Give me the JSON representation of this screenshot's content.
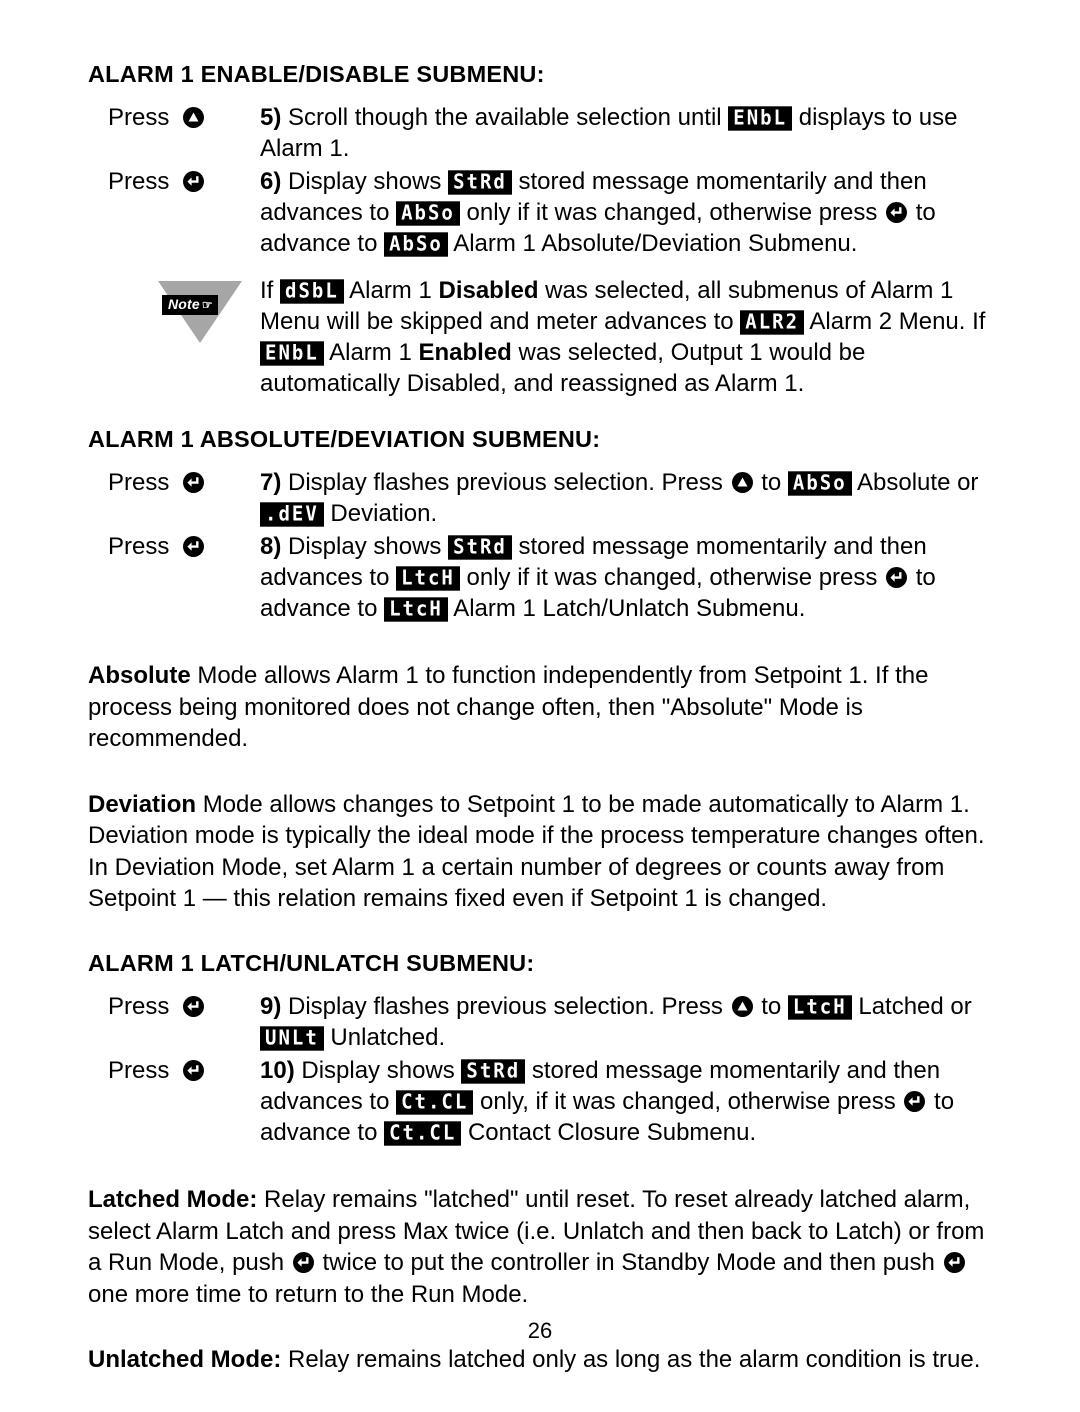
{
  "page": {
    "number": "26"
  },
  "icons": {
    "up_key": "up-arrow-key-icon",
    "enter_key": "enter-key-icon",
    "note": "note-triangle-icon",
    "note_label": "Note",
    "note_hand": "☞"
  },
  "sections": [
    {
      "id": "alarm1-enable-disable",
      "heading": "ALARM 1 ENABLE/DISABLE SUBMENU:",
      "steps": [
        {
          "press_label": "Press",
          "key": "up",
          "number": "5)",
          "parts": [
            {
              "t": "text",
              "v": " Scroll though the available selection until "
            },
            {
              "t": "lcd",
              "v": "ENbL"
            },
            {
              "t": "text",
              "v": " displays to use Alarm 1."
            }
          ]
        },
        {
          "press_label": "Press",
          "key": "enter",
          "number": "6)",
          "parts": [
            {
              "t": "text",
              "v": " Display shows "
            },
            {
              "t": "lcd",
              "v": "StRd"
            },
            {
              "t": "text",
              "v": " stored message momentarily and then advances to "
            },
            {
              "t": "lcd",
              "v": "AbSo"
            },
            {
              "t": "text",
              "v": " only if it was changed, otherwise press "
            },
            {
              "t": "key",
              "v": "enter"
            },
            {
              "t": "text",
              "v": " to advance to "
            },
            {
              "t": "lcd",
              "v": "AbSo"
            },
            {
              "t": "text",
              "v": " Alarm 1 Absolute/Deviation Submenu."
            }
          ]
        }
      ]
    },
    {
      "id": "alarm1-absolute-deviation",
      "heading": "ALARM 1 ABSOLUTE/DEVIATION SUBMENU:",
      "steps": [
        {
          "press_label": "Press",
          "key": "enter",
          "number": "7)",
          "parts": [
            {
              "t": "text",
              "v": " Display flashes previous selection. Press "
            },
            {
              "t": "key",
              "v": "up"
            },
            {
              "t": "text",
              "v": " to "
            },
            {
              "t": "lcd",
              "v": "AbSo"
            },
            {
              "t": "text",
              "v": " Absolute or "
            },
            {
              "t": "lcd",
              "v": ".dEV"
            },
            {
              "t": "text",
              "v": " Deviation."
            }
          ]
        },
        {
          "press_label": "Press",
          "key": "enter",
          "number": "8)",
          "parts": [
            {
              "t": "text",
              "v": " Display shows "
            },
            {
              "t": "lcd",
              "v": "StRd"
            },
            {
              "t": "text",
              "v": " stored message momentarily and then advances to "
            },
            {
              "t": "lcd",
              "v": "LtcH"
            },
            {
              "t": "text",
              "v": " only if it was changed, otherwise press "
            },
            {
              "t": "key",
              "v": "enter"
            },
            {
              "t": "text",
              "v": " to advance to "
            },
            {
              "t": "lcd",
              "v": "LtcH"
            },
            {
              "t": "text",
              "v": " Alarm 1 Latch/Unlatch Submenu."
            }
          ]
        }
      ]
    },
    {
      "id": "alarm1-latch-unlatch",
      "heading": "ALARM 1 LATCH/UNLATCH SUBMENU:",
      "steps": [
        {
          "press_label": "Press",
          "key": "enter",
          "number": "9)",
          "parts": [
            {
              "t": "text",
              "v": " Display flashes previous selection. Press "
            },
            {
              "t": "key",
              "v": "up"
            },
            {
              "t": "text",
              "v": " to "
            },
            {
              "t": "lcd",
              "v": "LtcH"
            },
            {
              "t": "text",
              "v": " Latched or "
            },
            {
              "t": "lcd",
              "v": "UNLt"
            },
            {
              "t": "text",
              "v": " Unlatched."
            }
          ]
        },
        {
          "press_label": "Press",
          "key": "enter",
          "number": "10)",
          "parts": [
            {
              "t": "text",
              "v": " Display shows "
            },
            {
              "t": "lcd",
              "v": "StRd"
            },
            {
              "t": "text",
              "v": " stored message momentarily and then advances to "
            },
            {
              "t": "lcd",
              "v": "Ct.CL"
            },
            {
              "t": "text",
              "v": " only, if it was changed, otherwise press "
            },
            {
              "t": "key",
              "v": "enter"
            },
            {
              "t": "text",
              "v": " to advance to "
            },
            {
              "t": "lcd",
              "v": "Ct.CL"
            },
            {
              "t": "text",
              "v": " Contact Closure Submenu."
            }
          ]
        }
      ]
    }
  ],
  "note": {
    "parts": [
      {
        "t": "text",
        "v": "If "
      },
      {
        "t": "lcd",
        "v": "dSbL"
      },
      {
        "t": "text",
        "v": " Alarm 1 "
      },
      {
        "t": "bold",
        "v": "Disabled"
      },
      {
        "t": "text",
        "v": " was selected, all submenus of Alarm 1 Menu will be skipped and meter advances to "
      },
      {
        "t": "lcd",
        "v": "ALR2"
      },
      {
        "t": "text",
        "v": " Alarm 2 Menu. If "
      },
      {
        "t": "lcd",
        "v": "ENbL"
      },
      {
        "t": "text",
        "v": " Alarm 1 "
      },
      {
        "t": "bold",
        "v": "Enabled"
      },
      {
        "t": "text",
        "v": " was selected, Output 1 would be automatically Disabled, and reassigned as Alarm 1."
      }
    ]
  },
  "paragraphs": {
    "absolute_mode": [
      {
        "t": "bold",
        "v": "Absolute"
      },
      {
        "t": "text",
        "v": " Mode allows Alarm 1 to function independently from Setpoint 1. If the process being monitored does not change often, then \"Absolute\" Mode is recommended."
      }
    ],
    "deviation_mode": [
      {
        "t": "bold",
        "v": "Deviation"
      },
      {
        "t": "text",
        "v": " Mode allows changes to Setpoint 1 to be made automatically to Alarm 1. Deviation mode is typically the ideal mode if the process temperature changes often. In Deviation Mode, set Alarm 1 a certain number of degrees or counts away from Setpoint 1 — this relation remains fixed even if Setpoint 1 is changed."
      }
    ],
    "latched_mode": [
      {
        "t": "bold",
        "v": "Latched Mode:"
      },
      {
        "t": "text",
        "v": " Relay remains \"latched\" until reset. To reset already latched alarm, select Alarm Latch and press Max twice (i.e. Unlatch and then back to Latch) or from a Run Mode, push "
      },
      {
        "t": "key",
        "v": "enter"
      },
      {
        "t": "text",
        "v": " twice to put the controller in Standby Mode and then push "
      },
      {
        "t": "key",
        "v": "enter"
      },
      {
        "t": "text",
        "v": " one more time to return to the Run Mode."
      }
    ],
    "unlatched_mode": [
      {
        "t": "bold",
        "v": "Unlatched Mode:"
      },
      {
        "t": "text",
        "v": " Relay remains latched only as long as the alarm condition is true."
      }
    ]
  }
}
